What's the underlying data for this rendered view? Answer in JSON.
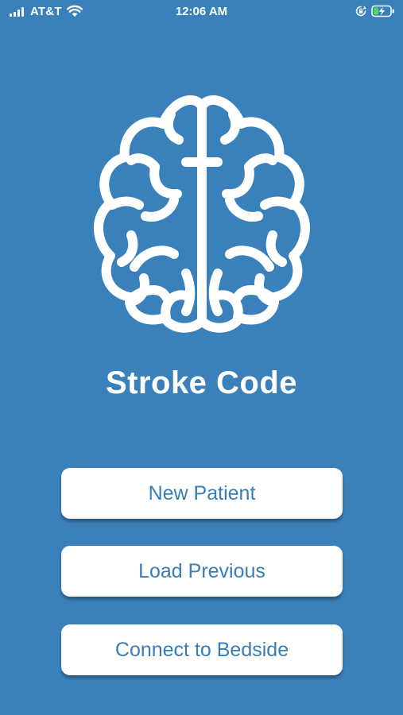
{
  "status_bar": {
    "carrier": "AT&T",
    "time": "12:06 AM",
    "icons": [
      "signal-bars-icon",
      "wifi-icon",
      "orientation-lock-icon",
      "battery-charging-icon"
    ]
  },
  "app": {
    "title": "Stroke Code",
    "logo_icon": "brain-icon"
  },
  "buttons": {
    "new_patient": "New Patient",
    "load_previous": "Load Previous",
    "connect_bedside": "Connect to Bedside"
  },
  "colors": {
    "background": "#3a80ba",
    "button_background": "#ffffff",
    "button_text": "#3a7db6",
    "title_text": "#ffffff",
    "battery_fill": "#4cd964"
  }
}
